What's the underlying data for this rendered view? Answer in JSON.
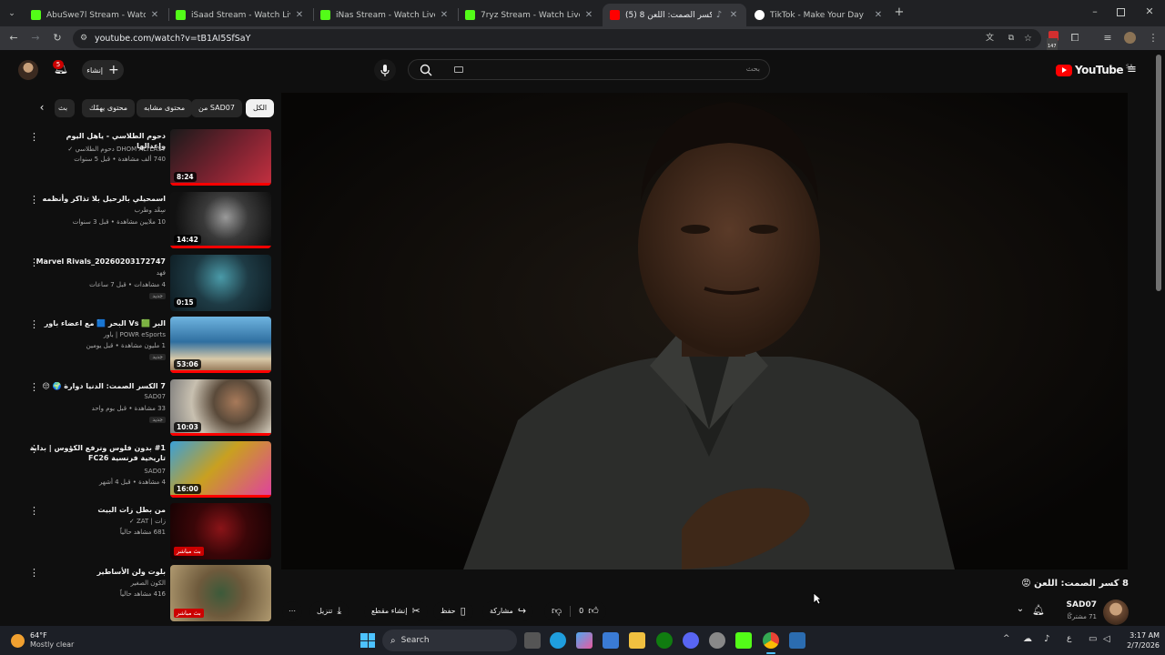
{
  "browser": {
    "tabs": [
      {
        "title": "AbuSwe7l Stream - Watch Live on Ki",
        "favicon_color": "#53fc18"
      },
      {
        "title": "iSaad Stream - Watch Live on Kick",
        "favicon_color": "#53fc18"
      },
      {
        "title": "iNas Stream - Watch Live on Kick",
        "favicon_color": "#53fc18"
      },
      {
        "title": "7ryz Stream - Watch Live on Kick",
        "favicon_color": "#53fc18"
      },
      {
        "title": "(5) 8 كسر الصمت: اللعن 😡",
        "favicon_color": "#ff0000"
      },
      {
        "title": "TikTok - Make Your Day",
        "favicon_color": "#ffffff"
      }
    ],
    "new_tab": "+",
    "url": "youtube.com/watch?v=tB1AI5SfSaY",
    "extension_badge": "147"
  },
  "youtube": {
    "logo_text": "YouTube",
    "logo_region": "SA",
    "search_placeholder": "بحث",
    "create_label": "إنشاء",
    "notifications_count": "5",
    "chips": [
      "الكل",
      "من SAD07",
      "محتوى مشابه",
      "محتوى يهمّك",
      "بث"
    ],
    "video": {
      "title": "8 كسر الصمت: اللعن 😡",
      "channel": "SAD07",
      "subscribers": "71 مشتركًا"
    },
    "actions": {
      "like_count": "0",
      "share": "مشاركة",
      "save": "حفظ",
      "clip": "إنشاء مقطع",
      "download": "تنزيل"
    },
    "recommendations": [
      {
        "title": "دحوم الطلاسي - ياهل اليوم وإعدالها",
        "channel": "DHOM ALTLASY دحوم الطلاسي ✓",
        "meta": "740 ألف مشاهدة • قبل 5 سنوات",
        "duration": "8:24",
        "badge": "",
        "thumb_color": "#7a2230"
      },
      {
        "title": "اسمحيلي بالرحيل بلا تذاكر وأنظمه",
        "channel": "سِعْد وطرب",
        "meta": "10 ملايين مشاهدة • قبل 3 سنوات",
        "duration": "14:42",
        "badge": "",
        "thumb_color": "#2a2a2a"
      },
      {
        "title": "Marvel Rivals_20260203172747",
        "channel": "فهد",
        "meta": "4 مشاهدات • قبل 7 ساعات",
        "duration": "0:15",
        "badge": "جديد",
        "thumb_color": "#1e3b45"
      },
      {
        "title": "البر 🟩 Vs البحر 🟦 مع اعضاء باور",
        "channel": "POWR eSports | باور",
        "meta": "1 مليون مشاهدة • قبل يومين",
        "duration": "53:06",
        "badge": "جديد",
        "thumb_color": "#2f6fa0"
      },
      {
        "title": "7 الكسر الصمت: الدنيا دوارة 🌍 😔",
        "channel": "SAD07",
        "meta": "33 مشاهدة • قبل يوم واحد",
        "duration": "10:03",
        "badge": "جديد",
        "thumb_color": "#5a4a3a"
      },
      {
        "title": "#1 بدون فلوس ونرفع الكؤوس | بداية تاريخية فرنسية FC26",
        "channel": "SAD07",
        "meta": "4 مشاهدة • قبل 4 أشهر",
        "duration": "16:00",
        "badge": "",
        "thumb_color": "#c9a020"
      },
      {
        "title": "من بطل زات البيت",
        "channel": "زات | ZAT ✓",
        "meta": "681 مشاهد حالياً",
        "duration": "",
        "badge": "",
        "live": "بث مباشر",
        "thumb_color": "#3a0608"
      },
      {
        "title": "بلوت ولن الأساطير",
        "channel": "الكون الصغير",
        "meta": "416 مشاهد حالياً",
        "duration": "",
        "badge": "",
        "live": "بث مباشر",
        "thumb_color": "#6e5a3c"
      }
    ]
  },
  "taskbar": {
    "weather_temp": "64°F",
    "weather_desc": "Mostly clear",
    "search_label": "Search",
    "time": "3:17 AM",
    "date": "2/7/2026",
    "lang": "ع"
  }
}
